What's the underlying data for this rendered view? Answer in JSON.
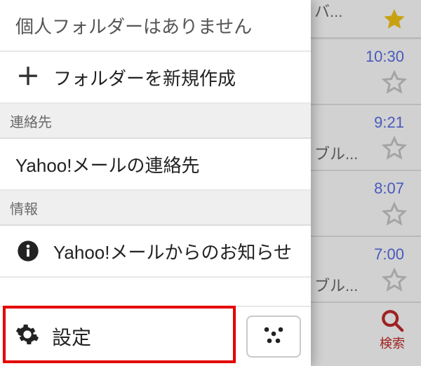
{
  "drawer": {
    "no_folder_label": "個人フォルダーはありません",
    "new_folder_label": "フォルダーを新規作成",
    "section_contacts": "連絡先",
    "contacts_label": "Yahoo!メールの連絡先",
    "section_info": "情報",
    "info_label": "Yahoo!メールからのお知らせ",
    "settings_label": "設定"
  },
  "mail": {
    "row0_snippet": "バ...",
    "row1_time": "10:30",
    "row2_time": "9:21",
    "row2_snippet": "ブル...",
    "row3_time": "8:07",
    "row4_time": "7:00",
    "row4_snippet": "ブル..."
  },
  "bottom": {
    "search_label": "検索"
  },
  "icons": {
    "plus": "plus-icon",
    "info": "info-icon",
    "gear": "gear-icon",
    "theme": "theme-icon",
    "star_filled": "star-filled-icon",
    "star_outline": "star-outline-icon",
    "search": "search-icon"
  }
}
